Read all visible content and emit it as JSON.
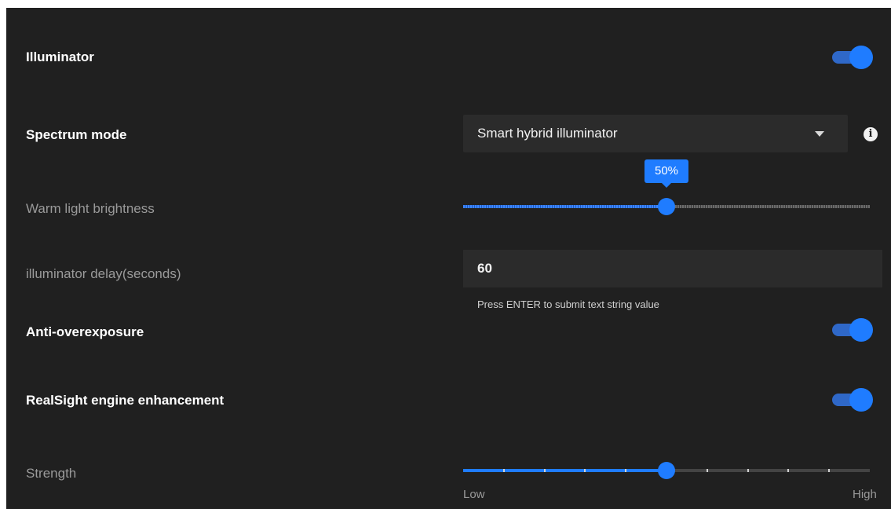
{
  "illuminator": {
    "label": "Illuminator",
    "enabled": true
  },
  "spectrum_mode": {
    "label": "Spectrum mode",
    "selected": "Smart hybrid illuminator",
    "info_icon": "info-icon"
  },
  "warm_light_brightness": {
    "label": "Warm light brightness",
    "value_percent": 50,
    "value_text": "50%"
  },
  "illuminator_delay": {
    "label": "illuminator delay(seconds)",
    "value": "60",
    "hint": "Press ENTER to submit text string value"
  },
  "anti_overexposure": {
    "label": "Anti-overexposure",
    "enabled": true
  },
  "realsight": {
    "label": "RealSight engine enhancement",
    "enabled": true
  },
  "strength": {
    "label": "Strength",
    "value_percent": 50,
    "steps": 10,
    "min_label": "Low",
    "max_label": "High"
  },
  "colors": {
    "accent": "#1f7cff",
    "background": "#202020"
  }
}
